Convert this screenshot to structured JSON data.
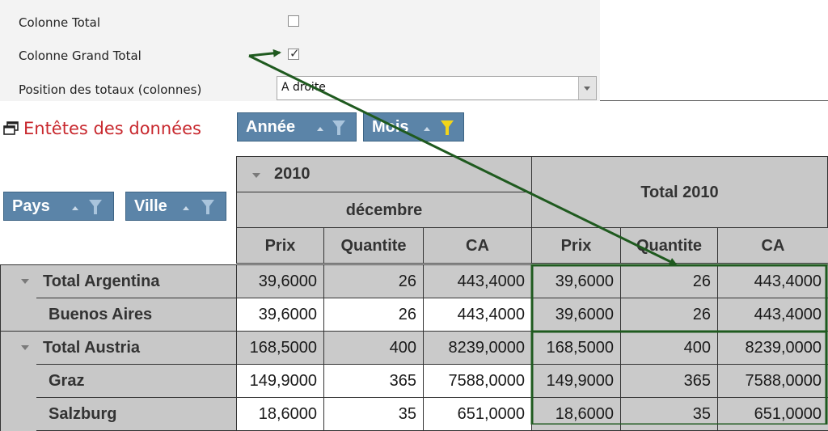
{
  "settings": {
    "total_col_label": "Colonne Total",
    "total_col_checked": false,
    "grand_total_col_label": "Colonne Grand Total",
    "grand_total_col_checked": true,
    "position_label": "Position des totaux (colonnes)",
    "position_value": "A droite"
  },
  "pivot": {
    "headers_title": "Entêtes des données",
    "column_fields": [
      "Année",
      "Mois"
    ],
    "row_fields": [
      "Pays",
      "Ville"
    ],
    "year": "2010",
    "month": "décembre",
    "total_header": "Total 2010",
    "measures": [
      "Prix",
      "Quantite",
      "CA",
      "Prix",
      "Quantite",
      "CA"
    ],
    "rows": [
      {
        "label": "Total Argentina",
        "subtotal": true,
        "values": [
          "39,6000",
          "26",
          "443,4000",
          "39,6000",
          "26",
          "443,4000"
        ]
      },
      {
        "label": "Buenos Aires",
        "subtotal": false,
        "values": [
          "39,6000",
          "26",
          "443,4000",
          "39,6000",
          "26",
          "443,4000"
        ]
      },
      {
        "label": "Total Austria",
        "subtotal": true,
        "values": [
          "168,5000",
          "400",
          "8239,0000",
          "168,5000",
          "400",
          "8239,0000"
        ]
      },
      {
        "label": "Graz",
        "subtotal": false,
        "values": [
          "149,9000",
          "365",
          "7588,0000",
          "149,9000",
          "365",
          "7588,0000"
        ]
      },
      {
        "label": "Salzburg",
        "subtotal": false,
        "values": [
          "18,6000",
          "35",
          "651,0000",
          "18,6000",
          "35",
          "651,0000"
        ]
      }
    ]
  },
  "colors": {
    "accent_title": "#c8282e",
    "field_button": "#5b84a8",
    "funnel_active": "#f3d51a",
    "funnel_inactive": "#a9c4dc",
    "annotation": "#1f5a1f",
    "header_gray": "#c8c8c8"
  }
}
